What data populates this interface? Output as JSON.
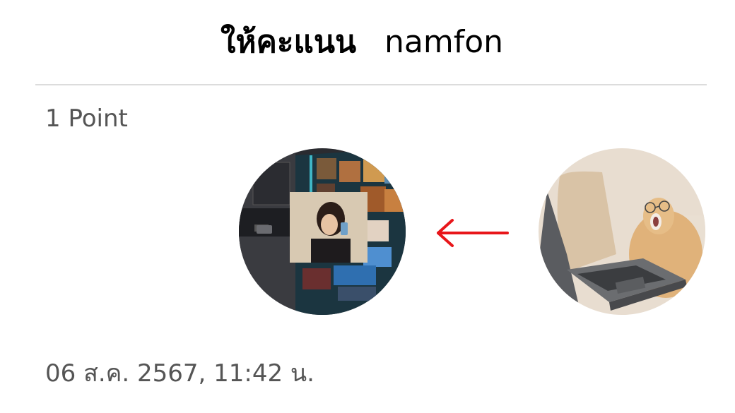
{
  "header": {
    "action_label": "ให้คะแนน",
    "username": "namfon"
  },
  "points_label": "1 Point",
  "direction_icon": "arrow-left-icon",
  "colors": {
    "arrow": "#e8161a",
    "secondary_text": "#555555",
    "divider": "#dcdcdc"
  },
  "timestamp": "06 ส.ค. 2567, 11:42 น."
}
